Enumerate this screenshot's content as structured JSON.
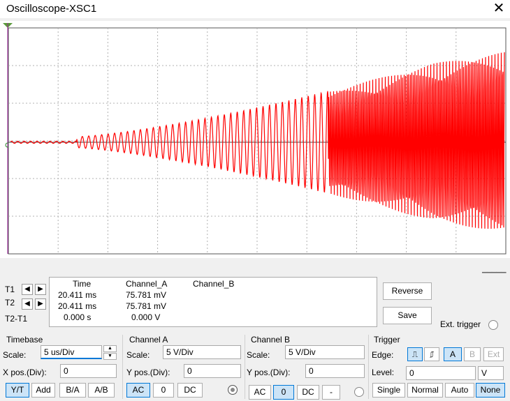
{
  "window": {
    "title": "Oscilloscope-XSC1",
    "close_glyph": "✕"
  },
  "cursors": {
    "t1_label": "T1",
    "t2_label": "T2",
    "t2t1_label": "T2-T1",
    "headers": {
      "time": "Time",
      "channel_a": "Channel_A",
      "channel_b": "Channel_B"
    },
    "rows": [
      {
        "time": "20.411 ms",
        "a": "75.781 mV",
        "b": ""
      },
      {
        "time": "20.411 ms",
        "a": "75.781 mV",
        "b": ""
      },
      {
        "time": "0.000 s",
        "a": "0.000 V",
        "b": ""
      }
    ],
    "reverse_label": "Reverse",
    "save_label": "Save",
    "ext_trigger_label": "Ext. trigger"
  },
  "timebase": {
    "title": "Timebase",
    "scale_label": "Scale:",
    "scale_value": "5 us/Div",
    "xpos_label": "X pos.(Div):",
    "xpos_value": "0",
    "modes": [
      "Y/T",
      "Add",
      "B/A",
      "A/B"
    ],
    "selected_mode": "Y/T"
  },
  "channel_a": {
    "title": "Channel A",
    "scale_label": "Scale:",
    "scale_value": "5  V/Div",
    "ypos_label": "Y pos.(Div):",
    "ypos_value": "0",
    "coupling": [
      "AC",
      "0",
      "DC"
    ],
    "selected": "AC"
  },
  "channel_b": {
    "title": "Channel B",
    "scale_label": "Scale:",
    "scale_value": "5  V/Div",
    "ypos_label": "Y pos.(Div):",
    "ypos_value": "0",
    "coupling": [
      "AC",
      "0",
      "DC",
      "-"
    ],
    "selected": "0"
  },
  "trigger": {
    "title": "Trigger",
    "edge_label": "Edge:",
    "edge_buttons": [
      "A",
      "B",
      "Ext"
    ],
    "level_label": "Level:",
    "level_value": "0",
    "level_unit": "V",
    "modes": [
      "Single",
      "Normal",
      "Auto",
      "None"
    ],
    "selected_mode": "None"
  },
  "colors": {
    "trace": "#ff0000",
    "accent": "#0078d7",
    "grid": "#b0b0b0"
  }
}
